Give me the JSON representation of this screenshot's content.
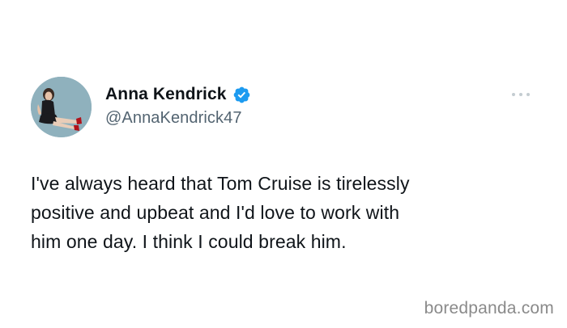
{
  "tweet": {
    "author": {
      "display_name": "Anna Kendrick",
      "handle": "@AnnaKendrick47",
      "verified": true,
      "avatar_icon": "profile-photo"
    },
    "text": "I've always heard that Tom Cruise is tirelessly\npositive and upbeat and I'd love to work with\nhim one day. I think I could break him.",
    "more_icon": "more-options-icon"
  },
  "watermark": {
    "text": "boredpanda.com"
  },
  "colors": {
    "background": "#ffffff",
    "text_primary": "#0f1419",
    "text_secondary": "#536471",
    "verified_blue": "#1d9bf0",
    "watermark": "#8a8a8a"
  }
}
